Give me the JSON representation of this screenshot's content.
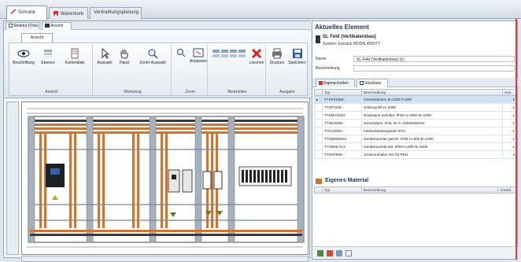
{
  "top_tabs": [
    {
      "label": "Schrank",
      "icon": "cabinet-icon"
    },
    {
      "label": "Warenkorb",
      "icon": "cart-icon"
    },
    {
      "label": "Verdrahtungsplanung",
      "icon": ""
    }
  ],
  "left_subtabs": [
    {
      "label": "Struktur (Orte)"
    },
    {
      "label": "Ansicht"
    }
  ],
  "ribbon": {
    "tab": "Ansicht",
    "groups": [
      {
        "label": "Ansicht",
        "buttons": [
          "Beschriftung",
          "Ebenen",
          "Kartenblatt"
        ]
      },
      {
        "label": "Werkzeug",
        "buttons": [
          "Auswahl",
          "Hand",
          "Zoom-Auswahl"
        ]
      },
      {
        "label": "Zoom",
        "buttons": [
          "Anpassen"
        ]
      },
      {
        "label": "Bearbeiten",
        "buttons": [
          "Löschen"
        ]
      },
      {
        "label": "Ausgabe",
        "buttons": [
          "Drucken",
          "Speichern"
        ]
      }
    ]
  },
  "right_panel": {
    "title": "Aktuelles Element",
    "element_name": "SL Feld (Vertikaleinbau)",
    "element_system": "System: Eckrack MOD6L4000TT",
    "name_label": "Name",
    "name_value": "SL Feld (Vertikaleinbau) (1)",
    "desc_label": "Beschreibung",
    "desc_value": "",
    "tabs": [
      {
        "label": "Eigenschaften"
      },
      {
        "label": "Stückliste"
      }
    ],
    "parts_headers": [
      "Typ",
      "Beschreibung",
      "Anz.",
      ""
    ],
    "parts": [
      {
        "typ": "TTSP01000-",
        "beschreibung": "Gerüstrahmen B=1000 T=600",
        "anz": "1"
      },
      {
        "typ": "TTSP*200--",
        "beschreibung": "Höhenprofil H=2000",
        "anz": "1"
      },
      {
        "typ": "TTSMY2010-",
        "beschreibung": "Rückwand zerlufter, IP30 H=2000 B=1000",
        "anz": "1"
      },
      {
        "typ": "TTNO3008--",
        "beschreibung": "Schutzdach, IP31, B=T=1000x600mm",
        "anz": "1"
      },
      {
        "typ": "TTAC0000--",
        "beschreibung": "Feldverbindungssatz IP31",
        "anz": "1"
      },
      {
        "typ": "TTSDM20610",
        "beschreibung": "Geräteraumtür geschl. IP55 H=600 B=1000",
        "anz": "1"
      },
      {
        "typ": "TTSDML*6-3",
        "beschreibung": "Geräteraumtür teil. IP55 H=600 B=1000",
        "anz": "1"
      },
      {
        "typ": "TTSSP000--",
        "beschreibung": "Schienenhalter HG für PEN",
        "anz": "2"
      }
    ],
    "own_material_title": "Eigenes Material",
    "own_headers": [
      "Typ",
      "Beschreibung",
      "Anzahl"
    ]
  }
}
